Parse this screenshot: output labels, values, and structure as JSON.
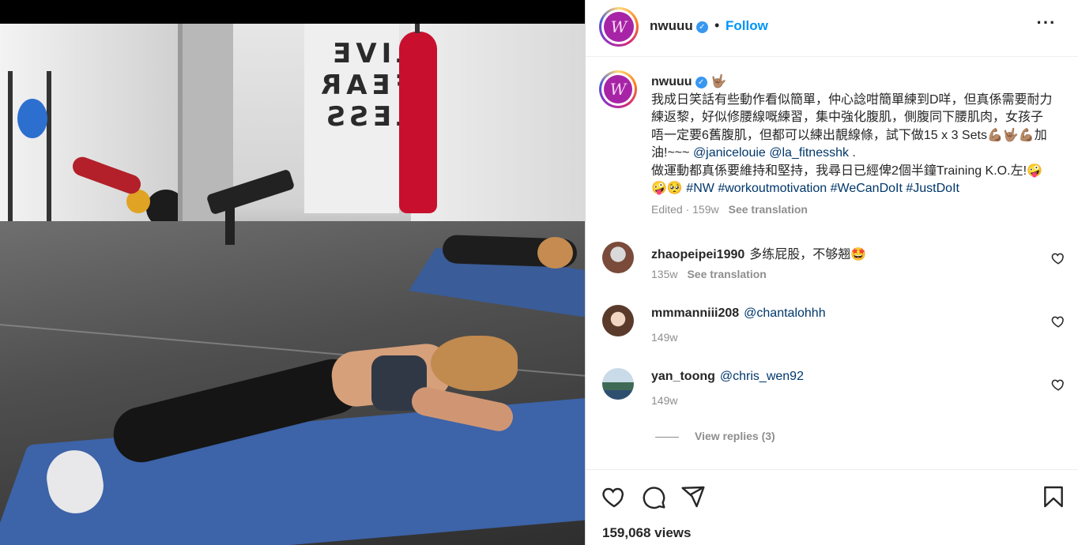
{
  "media": {
    "wall_text": [
      "LIVE",
      "FEAR",
      "LESS"
    ],
    "punching_bag_color": "#c8102e",
    "mat_color": "#3d63a8"
  },
  "post_header": {
    "username": "nwuuu",
    "verified_icon": "verified-badge-icon",
    "separator": "•",
    "follow_label": "Follow",
    "more_icon": "more-options-icon",
    "more_glyph": "···",
    "avatar_letter": "W"
  },
  "caption": {
    "username": "nwuuu",
    "emoji_after_name": "🤟🏽",
    "text_part1": "我成日笑話有些動作看似簡單，仲心諗咁簡單練到D咩，但真係需要耐力練返黎，好似修腰線嘅練習，集中強化腹肌，側腹同下腰肌肉，女孩子唔一定要6舊腹肌，但都可以練出靚線條，試下做15 x 3 Sets💪🏽🤟🏽💪🏽加油!~~~ ",
    "mention1": "@janicelouie",
    "mention2": "@la_fitnesshk",
    "text_part2": " .",
    "text_part3": "做運動都真係要維持和堅持，我尋日已經俾2個半鐘Training K.O.左!🤪🤪🥺 ",
    "hashtags": [
      "#NW",
      "#workoutmotivation",
      "#WeCanDoIt",
      "#JustDoIt"
    ],
    "edited_time": "Edited · 159w",
    "see_translation": "See translation"
  },
  "comments": [
    {
      "username": "zhaopeipei1990",
      "text": "多练屁股，不够翘🤩",
      "mention": "",
      "time": "135w",
      "see_translation": "See translation",
      "avatar_color": "#7a4a3a"
    },
    {
      "username": "mmmanniii208",
      "text": "",
      "mention": "@chantalohhh",
      "time": "149w",
      "see_translation": "",
      "avatar_color": "#d9b9a6"
    },
    {
      "username": "yan_toong",
      "text": "",
      "mention": "@chris_wen92",
      "time": "149w",
      "see_translation": "",
      "avatar_color": "#6f8fb0"
    }
  ],
  "view_replies": "View replies (3)",
  "actions": {
    "like_icon": "heart-icon",
    "comment_icon": "comment-icon",
    "share_icon": "share-icon",
    "save_icon": "bookmark-icon"
  },
  "views": "159,068 views",
  "colors": {
    "accent": "#0095f6",
    "link": "#00376b",
    "muted": "#8e8e8e",
    "verified": "#3897f0"
  }
}
